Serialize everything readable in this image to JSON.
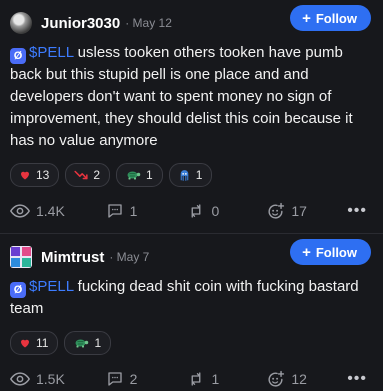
{
  "posts": [
    {
      "username": "Junior3030",
      "date": "· May 12",
      "follow_label": "Follow",
      "coin_badge": "Ø",
      "ticker": "$PELL",
      "text": " usless tooken others tooken have pumb back but this stupid pell is one place and and developers don't want to spent money no sign of improvement, they should delist this coin because it has no value anymore",
      "reactions": [
        {
          "icon": "heart-icon",
          "count": "13"
        },
        {
          "icon": "trend-down-icon",
          "count": "2"
        },
        {
          "icon": "turtle-icon",
          "count": "1"
        },
        {
          "icon": "squid-icon",
          "count": "1"
        }
      ],
      "actions": {
        "views": "1.4K",
        "comments": "1",
        "reposts": "0",
        "likes": "17"
      }
    },
    {
      "username": "Mimtrust",
      "date": "· May 7",
      "follow_label": "Follow",
      "coin_badge": "Ø",
      "ticker": "$PELL",
      "text": " fucking dead shit coin with fucking bastard team",
      "reactions": [
        {
          "icon": "heart-icon",
          "count": "11"
        },
        {
          "icon": "turtle-icon",
          "count": "1"
        }
      ],
      "actions": {
        "views": "1.5K",
        "comments": "2",
        "reposts": "1",
        "likes": "12"
      }
    }
  ],
  "colors": {
    "background": "#17181c",
    "accent": "#2e6ff2",
    "ticker": "#3d7cff",
    "heart": "#e8343f",
    "trend_down": "#e8343f"
  }
}
